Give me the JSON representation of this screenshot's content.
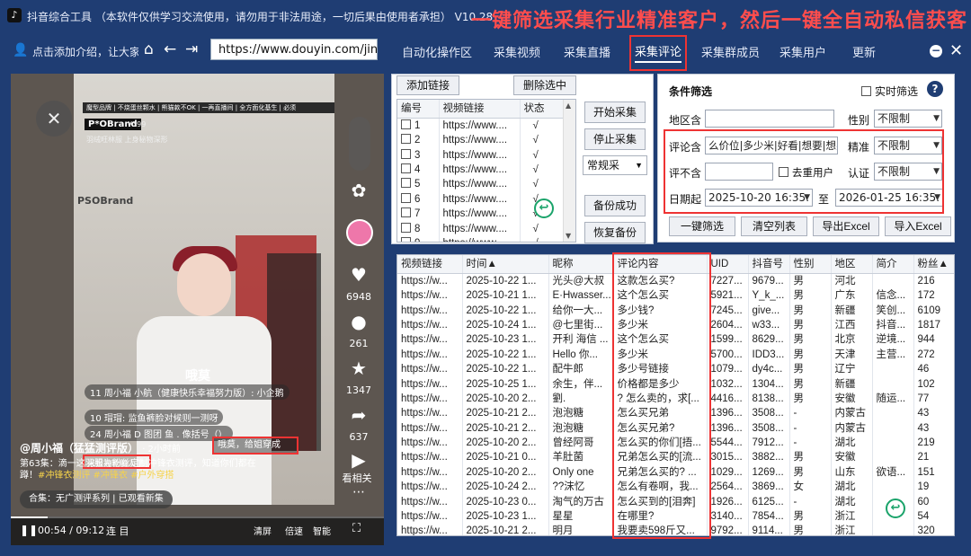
{
  "titlebar": {
    "logo_glyph": "♪",
    "title": "抖音综合工具 （本软件仅供学习交流使用，请勿用于非法用途，一切后果由使用者承担） V10.28",
    "promo": "一键筛选采集行业精准客户，然后一键全自动私信获客"
  },
  "navbar": {
    "user_icon": "👤",
    "hint": "点击添加介绍，让大家认识你",
    "home_glyph": "⌂",
    "back_glyph": "←",
    "forward_glyph": "⇥",
    "url": "https://www.douyin.com/jingxuan",
    "tabs": [
      "自动化操作区",
      "采集视频",
      "采集直播",
      "采集评论",
      "采集群成员",
      "采集用户",
      "更新"
    ],
    "active_tab": "采集评论",
    "min_glyph": "−",
    "close_glyph": "✕"
  },
  "video": {
    "top_strip": "魔型品牌 | 不烧蛋丝颗水 | 熊猫款不OK | 一再直播间 | 全方面化基生 | 必须",
    "brand_tag": "P*OBrand",
    "brand_price": "¥399",
    "promo_line": "羽绒旺林服 上身秘物深形",
    "brand_sign": "PSOBrand",
    "close_glyph": "✕",
    "right_actions": [
      {
        "icon": "✿",
        "label": ""
      },
      {
        "icon": "♥",
        "label": "6948"
      },
      {
        "icon": "●",
        "label": "261"
      },
      {
        "icon": "★",
        "label": "1347"
      },
      {
        "icon": "➦",
        "label": "637"
      },
      {
        "icon": "▶",
        "label": "看相关"
      }
    ],
    "danmu": [
      "11 周小福 小航（健康快乐幸福努力版）: 小企鹅",
      "10 瑁瑁: 监鱼裤脸对候则一测呀",
      "24 周小福 D 图团 鱼 . 像括号（）"
    ],
    "big_word": "哦莫",
    "author": "@周小福（猛猛测评版）",
    "author_suffix": "· 2小时前",
    "episode": "第63集：滴一这羽服为粉丝定制冲锋衣测评，知道你们都在蹲！",
    "episode_tags": "#冲锋衣测评 #冲锋衣 #户外穿搭",
    "collection": "合集：无广测评系列 | 已观看新集",
    "comment_box": "哦莫，给姐穿成",
    "redbox2_text": "米姐被轮髓人了",
    "time": "00:54 / 09:12",
    "progress": 0.098,
    "play_glyph": "❚❚",
    "ctrl_1": "连 目",
    "ctrl_2": "清屏",
    "ctrl_3": "倍速",
    "ctrl_4": "智能",
    "ctrl_5": "⛶"
  },
  "link_panel": {
    "add_btn": "添加链接",
    "delete_btn": "删除选中",
    "headers": [
      "编号",
      "视频链接",
      "状态"
    ],
    "rows": [
      {
        "no": "1",
        "url": "https://www....",
        "status": "√"
      },
      {
        "no": "2",
        "url": "https://www....",
        "status": "√"
      },
      {
        "no": "3",
        "url": "https://www....",
        "status": "√"
      },
      {
        "no": "4",
        "url": "https://www....",
        "status": "√"
      },
      {
        "no": "5",
        "url": "https://www....",
        "status": "√"
      },
      {
        "no": "6",
        "url": "https://www....",
        "status": "√"
      },
      {
        "no": "7",
        "url": "https://www....",
        "status": "√"
      },
      {
        "no": "8",
        "url": "https://www....",
        "status": "√"
      },
      {
        "no": "9",
        "url": "https://www....",
        "status": "√"
      }
    ],
    "start_btn": "开始采集",
    "stop_btn": "停止采集",
    "mode_value": "常规采",
    "backup_btn": "备份成功",
    "restore_btn": "恢复备份"
  },
  "filter": {
    "title": "条件筛选",
    "realtime_label": "实时筛选",
    "help_glyph": "?",
    "region_label": "地区含",
    "region_value": "",
    "gender_label": "性别",
    "gender_value": "不限制",
    "comment_include_label": "评论含",
    "comment_include_value": "么价位|多少米|好看|想要|想买",
    "precise_label": "精准",
    "precise_value": "不限制",
    "comment_exclude_label": "评不含",
    "comment_exclude_value": "",
    "dedupe_label": "去重用户",
    "verify_label": "认证",
    "verify_value": "不限制",
    "date_label": "日期起",
    "date_from": "2025-10-20 16:35:",
    "date_to_label": "至",
    "date_to": "2026-01-25 16:35:",
    "btn_filter": "一键筛选",
    "btn_clear": "清空列表",
    "btn_export": "导出Excel",
    "btn_import": "导入Excel"
  },
  "results": {
    "headers": [
      "视频链接",
      "时间▲",
      "昵称",
      "评论内容",
      "UID",
      "抖音号",
      "性别",
      "地区",
      "简介",
      "粉丝▲"
    ],
    "rows": [
      [
        "https://w...",
        "2025-10-22 1...",
        "光头@大叔",
        "这款怎么买?",
        "7227...",
        "9679...",
        "男",
        "河北",
        "",
        "216"
      ],
      [
        "https://w...",
        "2025-10-21 1...",
        "E·Hwasser...",
        "这个怎么买",
        "5921...",
        "Y_k_...",
        "男",
        "广东",
        "信念...",
        "172"
      ],
      [
        "https://w...",
        "2025-10-22 1...",
        "给你一大...",
        "多少钱?",
        "7245...",
        "give...",
        "男",
        "新疆",
        "笑创...",
        "6109"
      ],
      [
        "https://w...",
        "2025-10-24 1...",
        "@七里街...",
        "多少米",
        "2604...",
        "w33...",
        "男",
        "江西",
        "抖音...",
        "1817"
      ],
      [
        "https://w...",
        "2025-10-23 1...",
        "开利 海信 ...",
        "这个怎么买",
        "1599...",
        "8629...",
        "男",
        "北京",
        "逆境...",
        "944"
      ],
      [
        "https://w...",
        "2025-10-22 1...",
        "Hello  你...",
        "多少米",
        "5700...",
        "IDD3...",
        "男",
        "天津",
        "主营...",
        "272"
      ],
      [
        "https://w...",
        "2025-10-22 1...",
        "配牛郎",
        "多少号链接",
        "1079...",
        "dy4c...",
        "男",
        "辽宁",
        "",
        "46"
      ],
      [
        "https://w...",
        "2025-10-25 1...",
        "余生，伴...",
        "价格都是多少",
        "1032...",
        "1304...",
        "男",
        "新疆",
        "",
        "102"
      ],
      [
        "https://w...",
        "2025-10-20 2...",
        "劉.",
        "? 怎么卖的，求[...",
        "4416...",
        "8138...",
        "男",
        "安徽",
        "随运...",
        "77"
      ],
      [
        "https://w...",
        "2025-10-21 2...",
        "泡泡糖",
        "怎么买兄弟",
        "1396...",
        "3508...",
        "-",
        "内蒙古",
        "",
        "43"
      ],
      [
        "https://w...",
        "2025-10-21 2...",
        "泡泡糖",
        "怎么买兄弟?",
        "1396...",
        "3508...",
        "-",
        "内蒙古",
        "",
        "43"
      ],
      [
        "https://w...",
        "2025-10-20 2...",
        "曾经阿哥",
        "怎么买的你们[捂...",
        "5544...",
        "7912...",
        "-",
        "湖北",
        "",
        "219"
      ],
      [
        "https://w...",
        "2025-10-21 0...",
        "羊肚菌",
        "兄弟怎么买的[流...",
        "3015...",
        "3882...",
        "男",
        "安徽",
        "",
        "21"
      ],
      [
        "https://w...",
        "2025-10-20 2...",
        "Only one",
        "兄弟怎么买的? ...",
        "1029...",
        "1269...",
        "男",
        "山东",
        "欲语...",
        "151"
      ],
      [
        "https://w...",
        "2025-10-24 2...",
        "??沫忆",
        "怎么有卷啊，我...",
        "2564...",
        "3869...",
        "女",
        "湖北",
        "",
        "19"
      ],
      [
        "https://w...",
        "2025-10-23 0...",
        "淘气的万古",
        "怎么买到的[泪奔]",
        "1926...",
        "6125...",
        "-",
        "湖北",
        "",
        "60"
      ],
      [
        "https://w...",
        "2025-10-23 1...",
        "星星",
        "在哪里?",
        "3140...",
        "7854...",
        "男",
        "浙江",
        "",
        "54"
      ],
      [
        "https://w...",
        "2025-10-21 2...",
        "明月",
        "我要卖598斤又...",
        "9792...",
        "9114...",
        "男",
        "浙江",
        "",
        "320"
      ]
    ]
  },
  "colors": {
    "accent_red": "#e33333",
    "title_bg": "#1f3d73",
    "check_green": "#1aa36a"
  }
}
